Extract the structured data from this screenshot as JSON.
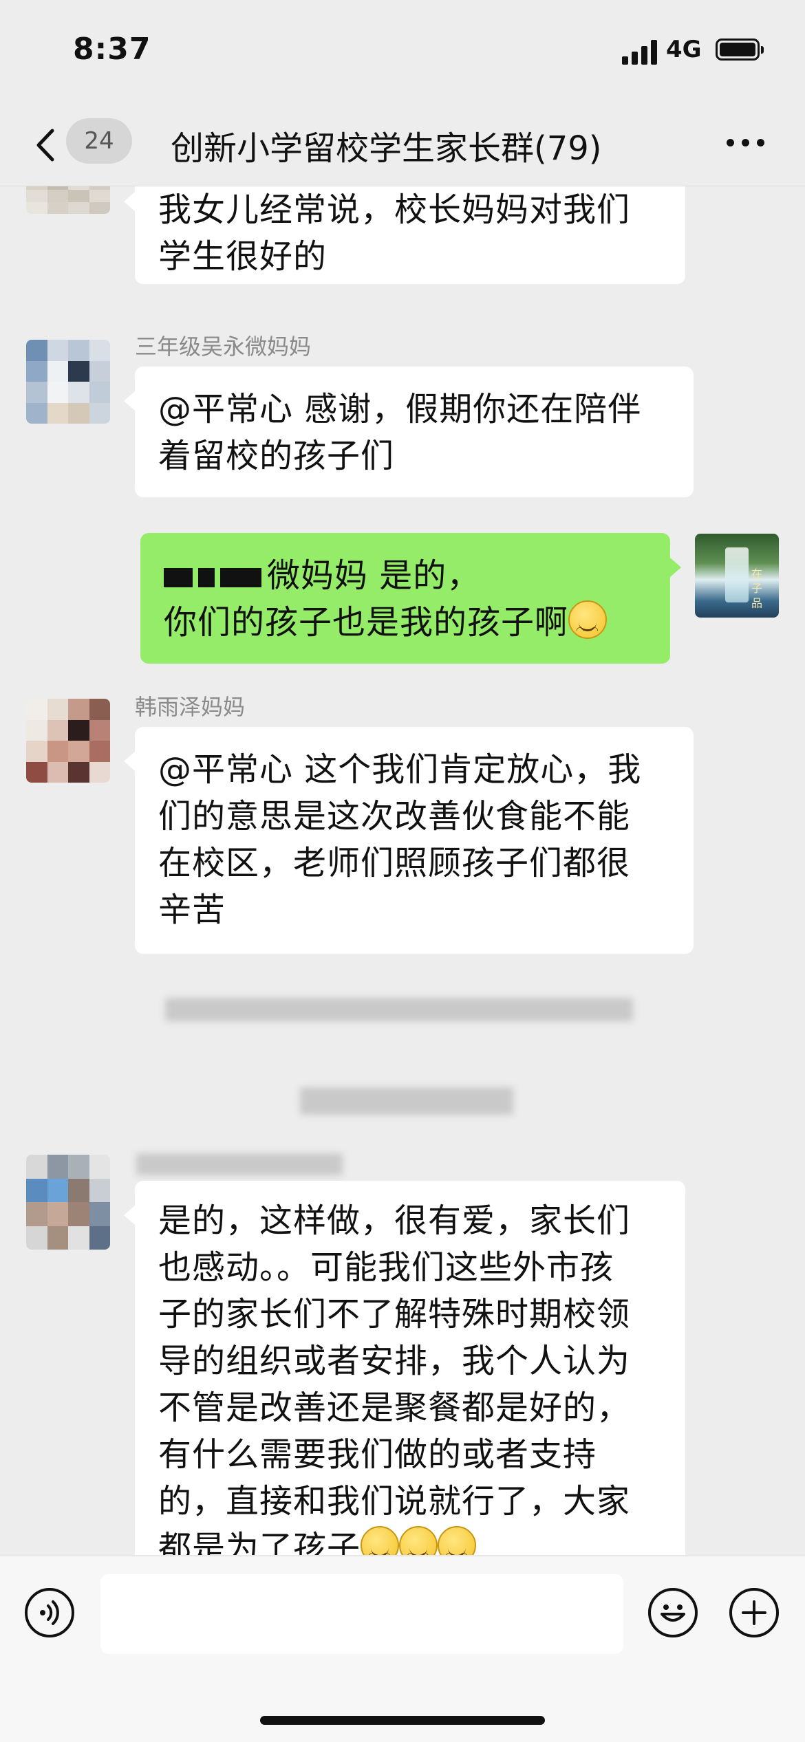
{
  "status_bar": {
    "time": "8:37",
    "network": "4G"
  },
  "nav": {
    "unread_count": "24",
    "title": "创新小学留校学生家长群(79)"
  },
  "messages": [
    {
      "lines": [
        "我女儿经常说，校长妈妈对我们",
        "学生很好的"
      ]
    },
    {
      "sender": "三年级吴永微妈妈",
      "lines": [
        "@平常心 感谢，假期你还在陪伴",
        "着留校的孩子们"
      ]
    },
    {
      "line1_visible": "微妈妈 是的，",
      "lines": [
        "你们的孩子也是我的孩子啊"
      ]
    },
    {
      "sender": "韩雨泽妈妈",
      "lines": [
        "@平常心 这个我们肯定放心，我",
        "们的意思是这次改善伙食能不能",
        "在校区，老师们照顾孩子们都很",
        "辛苦"
      ]
    },
    {
      "lines": [
        "是的，这样做，很有爱，家长们",
        "也感动。。可能我们这些外市孩",
        "子的家长们不了解特殊时期校领",
        "导的组织或者安排，我个人认为",
        "不管是改善还是聚餐都是好的，",
        "有什么需要我们做的或者支持",
        "的，直接和我们说就行了，大家",
        "都是为了孩子"
      ]
    }
  ],
  "avatar_text": {
    "self_avatar": "在 子 品"
  },
  "icons": {
    "back": "chevron-left-icon",
    "more": "ellipsis-icon",
    "voice": "voice-icon",
    "emoji": "emoji-icon",
    "add": "plus-icon"
  },
  "colors": {
    "self_bubble": "#95ec69",
    "other_bubble": "#ffffff",
    "background": "#ededed"
  }
}
